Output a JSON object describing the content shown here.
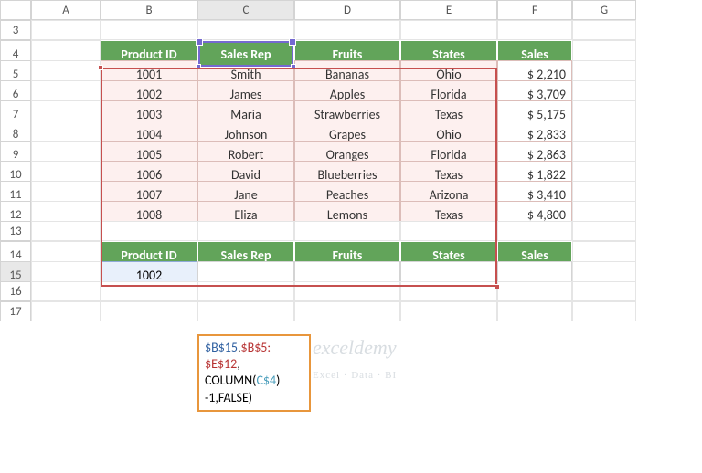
{
  "cols": [
    "A",
    "B",
    "C",
    "D",
    "E",
    "F",
    "G"
  ],
  "rows": [
    "3",
    "4",
    "5",
    "6",
    "7",
    "8",
    "9",
    "10",
    "11",
    "12",
    "13",
    "14",
    "15",
    "16",
    "17"
  ],
  "headers": {
    "h0": "Product ID",
    "h1": "Sales Rep",
    "h2": "Fruits",
    "h3": "States",
    "h4": "Sales"
  },
  "data": [
    {
      "id": "1001",
      "rep": "Smith",
      "fruit": "Bananas",
      "state": "Ohio",
      "sales": "$  2,210"
    },
    {
      "id": "1002",
      "rep": "James",
      "fruit": "Apples",
      "state": "Florida",
      "sales": "$  3,709"
    },
    {
      "id": "1003",
      "rep": "Maria",
      "fruit": "Strawberries",
      "state": "Texas",
      "sales": "$  5,175"
    },
    {
      "id": "1004",
      "rep": "Johnson",
      "fruit": "Grapes",
      "state": "Ohio",
      "sales": "$  2,833"
    },
    {
      "id": "1005",
      "rep": "Robert",
      "fruit": "Oranges",
      "state": "Florida",
      "sales": "$  2,863"
    },
    {
      "id": "1006",
      "rep": "David",
      "fruit": "Blueberries",
      "state": "Texas",
      "sales": "$  1,822"
    },
    {
      "id": "1007",
      "rep": "Jane",
      "fruit": "Peaches",
      "state": "Arizona",
      "sales": "$  3,410"
    },
    {
      "id": "1008",
      "rep": "Eliza",
      "fruit": "Lemons",
      "state": "Texas",
      "sales": "$  4,800"
    }
  ],
  "lookup": {
    "id": "1002"
  },
  "formula": {
    "p1": "$B$15",
    "p2": "$B$5:",
    "p3": "$E$12",
    "p4": "COLUMN(",
    "p5": "C$4",
    "p6": ")",
    "p7": "-1,FALSE)"
  },
  "watermark": {
    "t1": "exceldemy",
    "t2": "Excel · Data · BI"
  }
}
